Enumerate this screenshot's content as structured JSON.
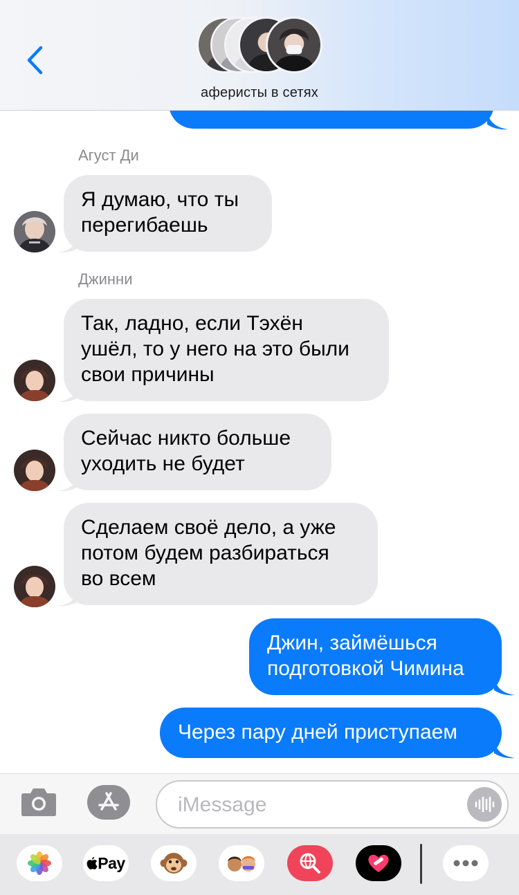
{
  "header": {
    "group_name": "аферисты в сетях"
  },
  "icons": {
    "back": "chevron-left-icon",
    "camera": "camera-icon",
    "app_store": "app-store-icon",
    "audio": "audio-waveform-icon",
    "more": "ellipsis-icon"
  },
  "colors": {
    "outgoing_bubble": "#0a7bfa",
    "incoming_bubble": "#e9e9eb",
    "accent": "#0a7bfa"
  },
  "messages": [
    {
      "direction": "out",
      "text": ""
    },
    {
      "direction": "in",
      "sender": "Агуст Ди",
      "lines": [
        "Я думаю, что ты",
        "перегибаешь"
      ]
    },
    {
      "direction": "in",
      "sender": "Джинни",
      "lines": [
        "Так, ладно, если Тэхён",
        "ушёл, то у него на это были",
        "свои причины"
      ]
    },
    {
      "direction": "in",
      "lines": [
        "Сейчас никто больше",
        "уходить не будет"
      ]
    },
    {
      "direction": "in",
      "lines": [
        "Сделаем своё дело, а уже",
        "потом будем разбираться",
        "во всем"
      ]
    },
    {
      "direction": "out",
      "lines": [
        "Джин, займёшься",
        "подготовкой Чимина"
      ]
    },
    {
      "direction": "out",
      "lines": [
        "Через пару дней приступаем"
      ]
    }
  ],
  "input": {
    "placeholder": "iMessage"
  },
  "drawer": {
    "apps": [
      "Photos",
      "Apple Pay",
      "Animoji",
      "Memoji",
      "Search Images",
      "Digital Touch",
      "More"
    ],
    "apple_pay_label": "Pay"
  }
}
